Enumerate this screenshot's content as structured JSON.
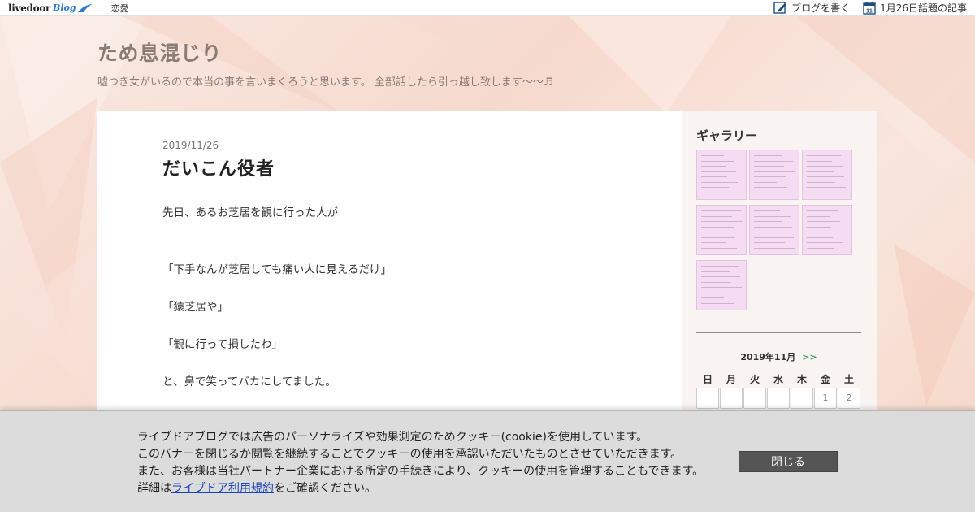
{
  "topbar": {
    "logo_text": "livedoor",
    "logo_blog": "Blog",
    "category": "恋愛",
    "write_blog": "ブログを書く",
    "calendar_day": "11",
    "topic_link": "1月26日話題の記事"
  },
  "header": {
    "title": "ため息混じり",
    "description": "嘘つき女がいるので本当の事を言いまくろうと思います。 全部話したら引っ越し致します〜〜♬"
  },
  "post": {
    "date": "2019/11/26",
    "title": "だいこん役者",
    "paragraphs": [
      "先日、あるお芝居を観に行った人が",
      "「下手なんが芝居しても痛い人に見えるだけ」",
      "「猿芝居や」",
      "「観に行って損したわ」",
      "と、鼻で笑ってバカにしてました。"
    ]
  },
  "sidebar": {
    "gallery_heading": "ギャラリー",
    "gallery_count": 7,
    "calendar": {
      "month_label": "2019年11月",
      "next_label": ">>",
      "weekdays": [
        "日",
        "月",
        "火",
        "水",
        "木",
        "金",
        "土"
      ],
      "first_row": [
        "",
        "",
        "",
        "",
        "",
        "1",
        "2"
      ]
    }
  },
  "cookie_banner": {
    "line1": "ライブドアブログでは広告のパーソナライズや効果測定のためクッキー(cookie)を使用しています。",
    "line2": "このバナーを閉じるか閲覧を継続することでクッキーの使用を承認いただいたものとさせていただきます。",
    "line3": "また、お客様は当社パートナー企業における所定の手続きにより、クッキーの使用を管理することもできます。",
    "line4_prefix": "詳細は",
    "terms_link": "ライブドア利用規約",
    "line4_suffix": "をご確認ください。",
    "close_label": "閉じる"
  },
  "colors": {
    "accent_blue": "#2f7dd0",
    "title_gray": "#8a7b75",
    "thumb_pink": "#f5dcf2",
    "next_green": "#2e9b4f",
    "banner_bg": "#dcdcdc",
    "button_bg": "#555555"
  }
}
